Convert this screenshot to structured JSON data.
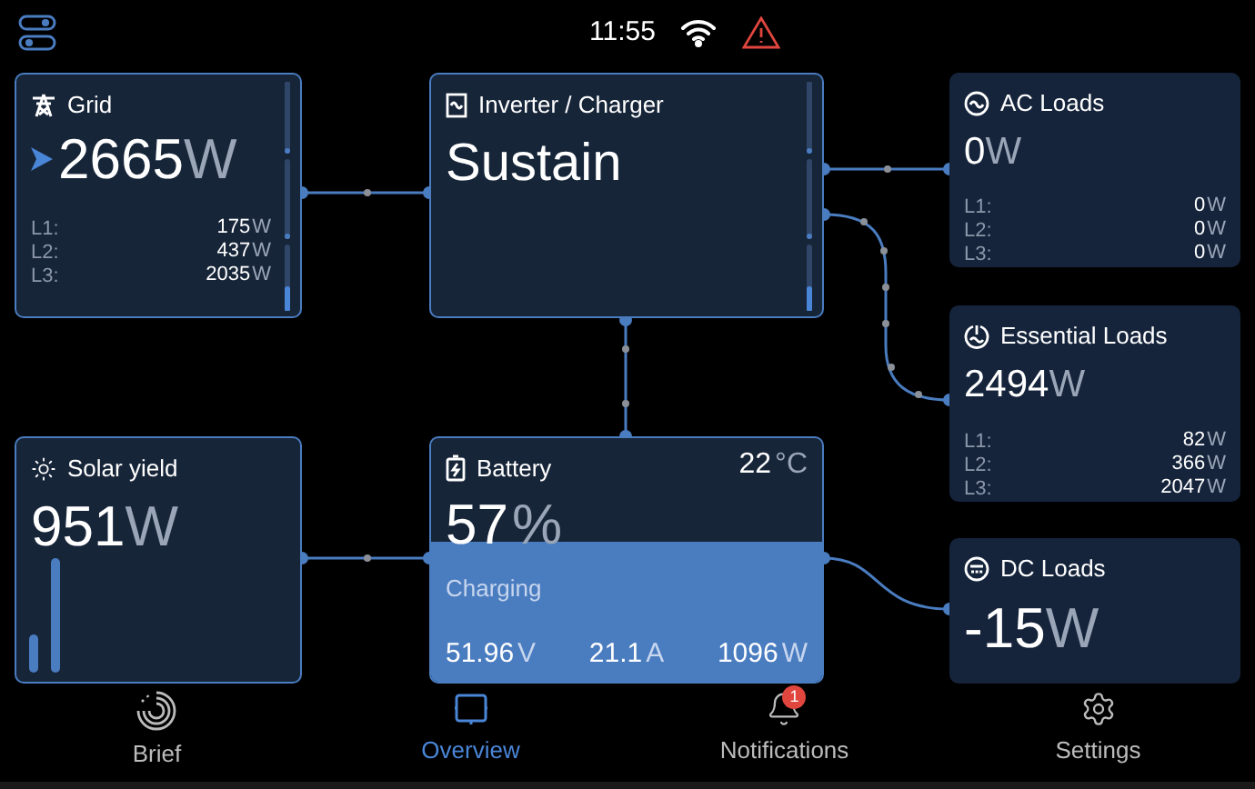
{
  "status_bar": {
    "time": "11:55"
  },
  "grid": {
    "title": "Grid",
    "value": "2665",
    "unit": "W",
    "phases": [
      {
        "label": "L1:",
        "value": "175",
        "unit": "W"
      },
      {
        "label": "L2:",
        "value": "437",
        "unit": "W"
      },
      {
        "label": "L3:",
        "value": "2035",
        "unit": "W"
      }
    ]
  },
  "inverter": {
    "title": "Inverter / Charger",
    "state": "Sustain"
  },
  "ac_loads": {
    "title": "AC Loads",
    "value": "0",
    "unit": "W",
    "phases": [
      {
        "label": "L1:",
        "value": "0",
        "unit": "W"
      },
      {
        "label": "L2:",
        "value": "0",
        "unit": "W"
      },
      {
        "label": "L3:",
        "value": "0",
        "unit": "W"
      }
    ]
  },
  "essential_loads": {
    "title": "Essential Loads",
    "value": "2494",
    "unit": "W",
    "phases": [
      {
        "label": "L1:",
        "value": "82",
        "unit": "W"
      },
      {
        "label": "L2:",
        "value": "366",
        "unit": "W"
      },
      {
        "label": "L3:",
        "value": "2047",
        "unit": "W"
      }
    ]
  },
  "solar": {
    "title": "Solar yield",
    "value": "951",
    "unit": "W"
  },
  "battery": {
    "title": "Battery",
    "temperature": "22",
    "temperature_unit": "°C",
    "value": "57",
    "unit": "%",
    "status": "Charging",
    "readings": [
      {
        "value": "51.96",
        "unit": "V"
      },
      {
        "value": "21.1",
        "unit": "A"
      },
      {
        "value": "1096",
        "unit": "W"
      }
    ]
  },
  "dc_loads": {
    "title": "DC Loads",
    "value": "-15",
    "unit": "W"
  },
  "nav": [
    {
      "kind": "brief",
      "label": "Brief",
      "selected": false
    },
    {
      "kind": "overview",
      "label": "Overview",
      "selected": true
    },
    {
      "kind": "notifications",
      "label": "Notifications",
      "selected": false,
      "badge": "1"
    },
    {
      "kind": "settings",
      "label": "Settings",
      "selected": false
    }
  ]
}
